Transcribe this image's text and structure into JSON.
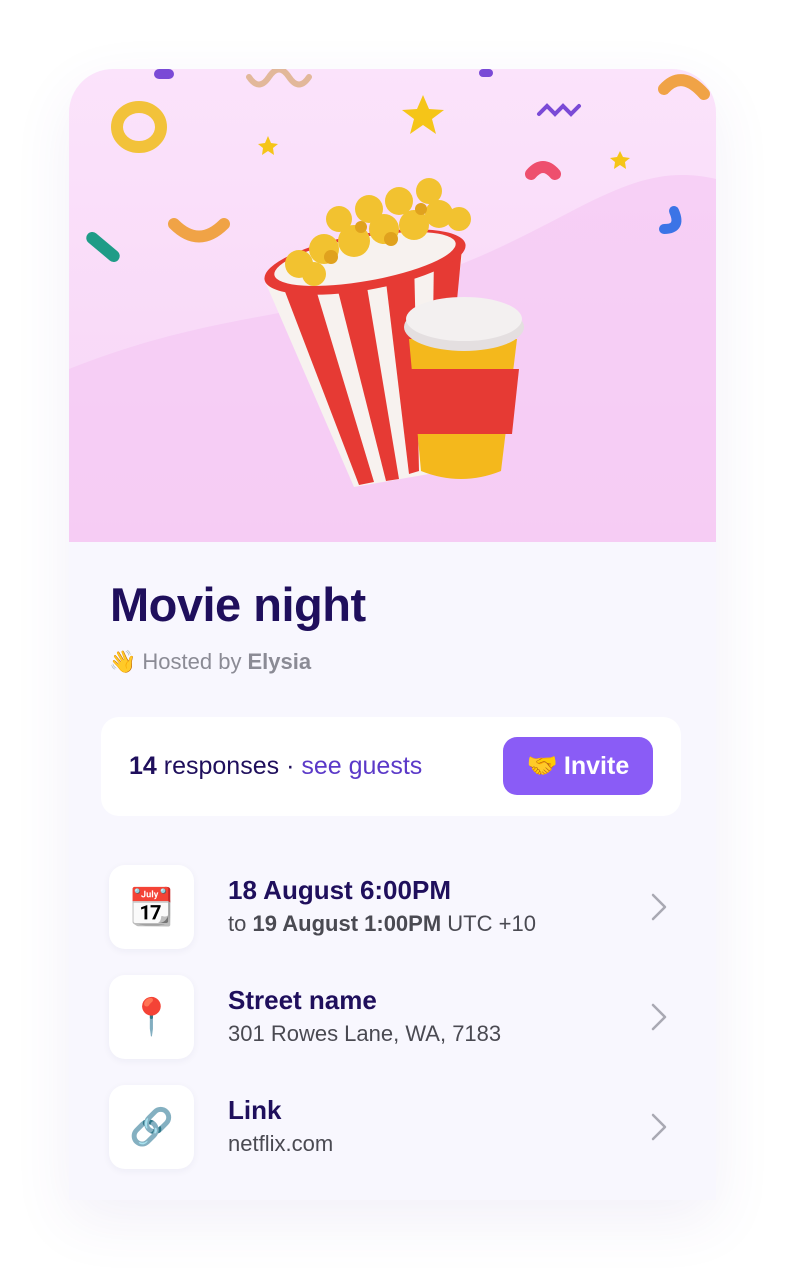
{
  "event": {
    "title": "Movie night",
    "host_emoji": "👋",
    "host_prefix": "Hosted by",
    "host_name": "Elysia"
  },
  "responses": {
    "count": "14",
    "label": "responses",
    "separator": "·",
    "see_guests": "see guests",
    "invite_emoji": "🤝",
    "invite_label": "Invite"
  },
  "details": [
    {
      "icon": "📆",
      "title": "18 August 6:00PM",
      "sub_prefix": "to",
      "sub_bold": "19 August 1:00PM",
      "sub_suffix": "UTC +10"
    },
    {
      "icon": "📍",
      "title": "Street name",
      "sub": "301 Rowes Lane, WA, 7183"
    },
    {
      "icon": "🔗",
      "title": "Link",
      "sub": "netflix.com"
    }
  ],
  "colors": {
    "accent": "#8a5cf6",
    "title": "#1f0f5c",
    "link": "#5b39c8",
    "hero_bg": "#f7d4f6"
  }
}
